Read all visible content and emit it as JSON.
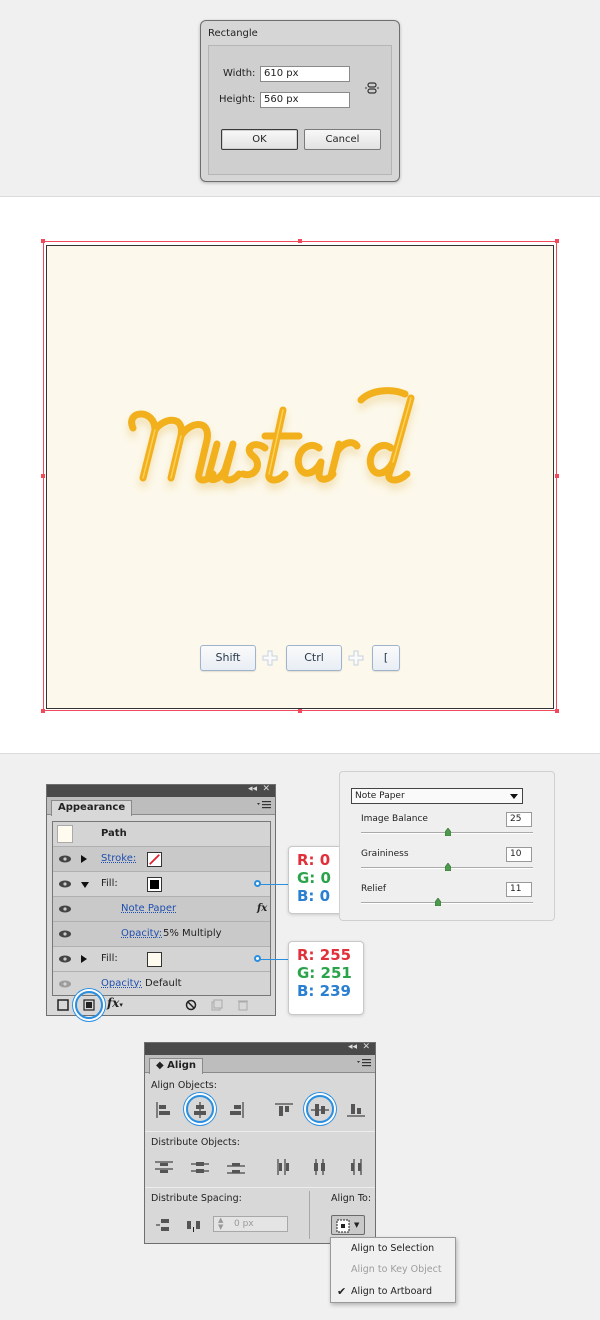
{
  "rectangle_dialog": {
    "title": "Rectangle",
    "width_label": "Width:",
    "width_value": "610 px",
    "height_label": "Height:",
    "height_value": "560 px",
    "ok_label": "OK",
    "cancel_label": "Cancel"
  },
  "artboard": {
    "colors": {
      "selection": "#f04a5c",
      "paper": "#fcf8eb",
      "mustard": "#f3b323"
    },
    "keys": [
      "Shift",
      "Ctrl",
      "["
    ]
  },
  "appearance": {
    "tab_label": "Appearance",
    "header": "Path",
    "stroke_label": "Stroke:",
    "fill_label_1": "Fill:",
    "note_paper_label": "Note Paper",
    "fx_label": "fx",
    "opacity_label_1": "Opacity:",
    "opacity_value_1": "5% Multiply",
    "fill_label_2": "Fill:",
    "opacity_label_2": "Opacity:",
    "opacity_value_2": "Default"
  },
  "color_callouts": {
    "black": {
      "r": "R: 0",
      "g": "G: 0",
      "b": "B: 0"
    },
    "cream": {
      "r": "R: 255",
      "g": "G: 251",
      "b": "B: 239"
    },
    "fill_colors": {
      "black": "#000000",
      "cream": "#fffbef"
    }
  },
  "note_paper": {
    "dropdown_value": "Note Paper",
    "image_balance_label": "Image Balance",
    "image_balance_value": "25",
    "graininess_label": "Graininess",
    "graininess_value": "10",
    "relief_label": "Relief",
    "relief_value": "11"
  },
  "align": {
    "tab_label": "Align",
    "align_objects_label": "Align Objects:",
    "distribute_objects_label": "Distribute Objects:",
    "distribute_spacing_label": "Distribute Spacing:",
    "align_to_label": "Align To:",
    "spacing_value": "0 px",
    "dropdown": {
      "align_to_selection": "Align to Selection",
      "align_to_key_object": "Align to Key Object",
      "align_to_artboard": "Align to Artboard",
      "checked": "✔"
    }
  }
}
